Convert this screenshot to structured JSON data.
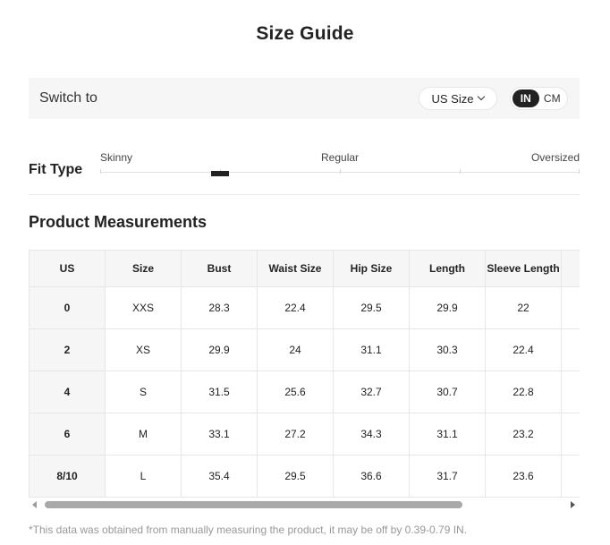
{
  "title": "Size Guide",
  "switch_bar": {
    "label": "Switch to",
    "size_system": "US Size",
    "units": [
      "IN",
      "CM"
    ],
    "active_unit": "IN"
  },
  "fit_type": {
    "label": "Fit Type",
    "scale": [
      "Skinny",
      "Regular",
      "Oversized"
    ],
    "selected_position": 0.25
  },
  "product_measurements": {
    "title": "Product Measurements",
    "columns": [
      "US",
      "Size",
      "Bust",
      "Waist Size",
      "Hip Size",
      "Length",
      "Sleeve Length"
    ],
    "rows": [
      [
        "0",
        "XXS",
        "28.3",
        "22.4",
        "29.5",
        "29.9",
        "22"
      ],
      [
        "2",
        "XS",
        "29.9",
        "24",
        "31.1",
        "30.3",
        "22.4"
      ],
      [
        "4",
        "S",
        "31.5",
        "25.6",
        "32.7",
        "30.7",
        "22.8"
      ],
      [
        "6",
        "M",
        "33.1",
        "27.2",
        "34.3",
        "31.1",
        "23.2"
      ],
      [
        "8/10",
        "L",
        "35.4",
        "29.5",
        "36.6",
        "31.7",
        "23.6"
      ]
    ]
  },
  "footnote": "*This data was obtained from manually measuring the product, it may be off by 0.39-0.79 IN.",
  "colors": {
    "accent": "#222222",
    "panel_bg": "#f6f6f6",
    "border": "#e6e6e6",
    "muted_text": "#999999"
  },
  "icons": {
    "dropdown": "chevron-down-icon",
    "scroll_left": "scroll-left-arrow-icon",
    "scroll_right": "scroll-right-arrow-icon"
  }
}
